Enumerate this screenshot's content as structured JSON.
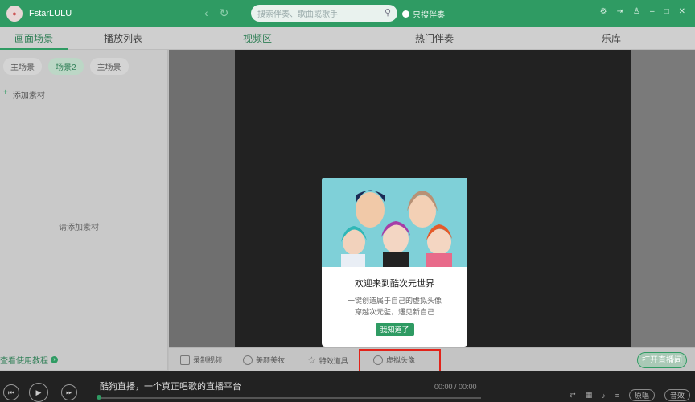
{
  "app": {
    "name": "FstarLULU"
  },
  "search": {
    "placeholder": "搜索伴奏、歌曲或歌手"
  },
  "only_accompaniment": "只搜伴奏",
  "tabs": [
    {
      "label": "画面场景"
    },
    {
      "label": "播放列表"
    },
    {
      "label": "视频区"
    },
    {
      "label": "热门伴奏"
    },
    {
      "label": "乐库"
    }
  ],
  "left": {
    "scenes": [
      "主场景",
      "场景2",
      "主场景"
    ],
    "add_material": "添加素材",
    "empty_hint": "请添加素材",
    "tutorial": "查看使用教程"
  },
  "dialog": {
    "title": "欢迎来到酷次元世界",
    "line1": "一键创造属于自己的虚拟头像",
    "line2": "穿越次元壁，遇见新自己",
    "button": "我知道了"
  },
  "toolbar": {
    "record": "录制视频",
    "beauty": "美颜美妆",
    "effects": "特效道具",
    "avatar": "虚拟头像",
    "go_live": "打开直播间"
  },
  "player": {
    "song": "酷狗直播，一个真正唱歌的直播平台",
    "time": "00:00 / 00:00",
    "original": "原唱",
    "accompaniment": "音效"
  },
  "colors": {
    "brand": "#2f9b63",
    "highlight": "#e2231a"
  }
}
